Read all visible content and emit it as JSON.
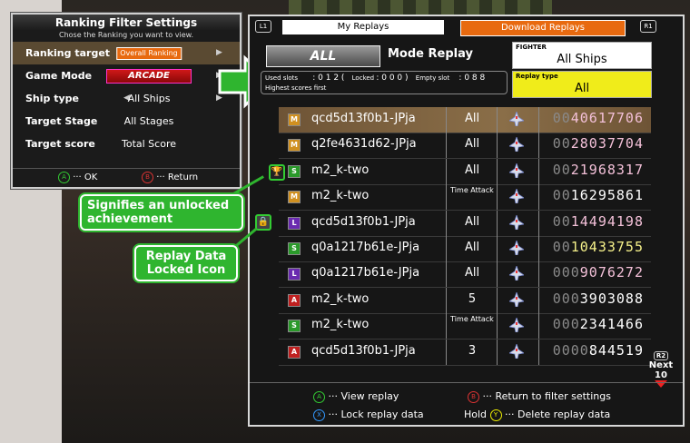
{
  "filter_panel": {
    "title": "Ranking Filter Settings",
    "subtitle": "Chose the Ranking you want to view.",
    "rows": [
      {
        "label": "Ranking target",
        "value": "Overall Ranking"
      },
      {
        "label": "Game Mode",
        "value": "ARCADE"
      },
      {
        "label": "Ship type",
        "value": "All Ships"
      },
      {
        "label": "Target Stage",
        "value": "All Stages"
      },
      {
        "label": "Target score",
        "value": "Total Score"
      }
    ],
    "footer_ok_button": "A",
    "footer_ok": "··· OK",
    "footer_return_button": "B",
    "footer_return": "··· Return"
  },
  "main_panel": {
    "l1": "L1",
    "r1": "R1",
    "tab_my_replays": "My Replays",
    "tab_download_replays": "Download Replays",
    "mode_badge": "ALL",
    "mode_title": "Mode Replay",
    "used_slots_label": "Used slots",
    "used_slots_value": ": 0 1 2 (",
    "locked_label": "Locked",
    "locked_value": ": 0 0 0 )",
    "empty_slot_label": "Empty slot",
    "empty_slot_value": ": 0 8 8",
    "highest_first": "Highest scores first",
    "fighter_label": "FIGHTER",
    "fighter_value": "All Ships",
    "replay_type_label": "Replay type",
    "replay_type_value": "All",
    "rows": [
      {
        "icon": "M",
        "name": "qcd5d13f0b1-JPja",
        "type": "All",
        "score_zeros": "00",
        "score": "40617706",
        "score_color": "#f3c0d8"
      },
      {
        "icon": "M",
        "name": "q2fe4631d62-JPja",
        "type": "All",
        "score_zeros": "00",
        "score": "28037704",
        "score_color": "#f3c0d8"
      },
      {
        "icon": "S",
        "name": "m2_k-two",
        "type": "All",
        "score_zeros": "00",
        "score": "21968317",
        "score_color": "#f3c0d8"
      },
      {
        "icon": "M",
        "name": "m2_k-two",
        "type": "Time Attack",
        "score_zeros": "00",
        "score": "16295861",
        "score_color": "#ffffff"
      },
      {
        "icon": "L",
        "name": "qcd5d13f0b1-JPja",
        "type": "All",
        "score_zeros": "00",
        "score": "14494198",
        "score_color": "#f3c0d8"
      },
      {
        "icon": "S",
        "name": "q0a1217b61e-JPja",
        "type": "All",
        "score_zeros": "00",
        "score": "10433755",
        "score_color": "#f5f08a"
      },
      {
        "icon": "L",
        "name": "q0a1217b61e-JPja",
        "type": "All",
        "score_zeros": "000",
        "score": "9076272",
        "score_color": "#f3c0d8"
      },
      {
        "icon": "A",
        "name": "m2_k-two",
        "type": "5",
        "score_zeros": "000",
        "score": "3903088",
        "score_color": "#ffffff"
      },
      {
        "icon": "S",
        "name": "m2_k-two",
        "type": "Time Attack",
        "score_zeros": "000",
        "score": "2341466",
        "score_color": "#ffffff"
      },
      {
        "icon": "A",
        "name": "qcd5d13f0b1-JPja",
        "type": "3",
        "score_zeros": "0000",
        "score": "844519",
        "score_color": "#ffffff"
      }
    ],
    "next_button": "R2",
    "next_label": "Next 10",
    "footer": {
      "view_button": "A",
      "view": "··· View replay",
      "return_button": "B",
      "return": "··· Return to filter settings",
      "lock_button": "X",
      "lock": "··· Lock replay data",
      "hold": "Hold",
      "delete_button": "Y",
      "delete": "··· Delete replay data"
    }
  },
  "callouts": {
    "achievement": "Signifies an unlocked achievement",
    "locked": "Replay Data Locked Icon"
  },
  "colors": {
    "accent_orange": "#e86a10",
    "callout_green": "#2fb52f",
    "replay_type_yellow": "#f0ec1a"
  }
}
